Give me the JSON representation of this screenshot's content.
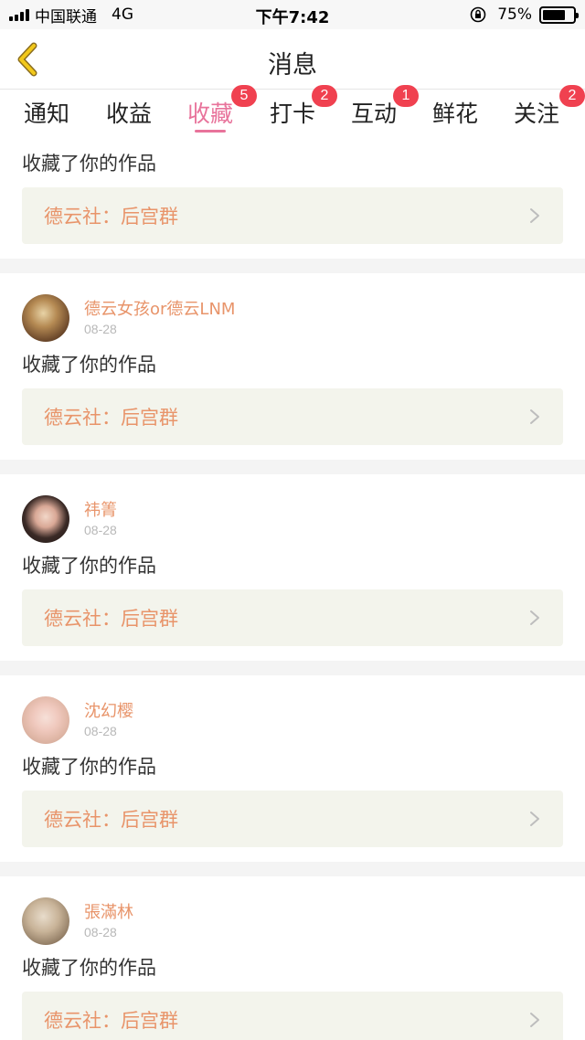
{
  "status_bar": {
    "carrier": "中国联通",
    "network": "4G",
    "time": "下午7:42",
    "battery": "75%",
    "battery_level": 0.75
  },
  "header": {
    "title": "消息",
    "back_icon": "chevron-left-icon"
  },
  "tabs": [
    {
      "label": "通知",
      "badge": null,
      "active": false
    },
    {
      "label": "收益",
      "badge": null,
      "active": false
    },
    {
      "label": "收藏",
      "badge": "5",
      "active": true
    },
    {
      "label": "打卡",
      "badge": "2",
      "active": false
    },
    {
      "label": "互动",
      "badge": "1",
      "active": false
    },
    {
      "label": "鲜花",
      "badge": null,
      "active": false
    },
    {
      "label": "关注",
      "badge": "2",
      "active": false
    }
  ],
  "colors": {
    "accent": "#e8739b",
    "badge": "#f04150",
    "username": "#e8946a",
    "work_box_bg": "#f3f4ec"
  },
  "feed": [
    {
      "action": "收藏了你的作品",
      "work_title": "德云社：后宫群"
    },
    {
      "username": "德云女孩or德云LNM",
      "date": "08-28",
      "action": "收藏了你的作品",
      "work_title": "德云社：后宫群"
    },
    {
      "username": "祎箐",
      "date": "08-28",
      "action": "收藏了你的作品",
      "work_title": "德云社：后宫群"
    },
    {
      "username": "沈幻樱",
      "date": "08-28",
      "action": "收藏了你的作品",
      "work_title": "德云社：后宫群"
    },
    {
      "username": "張滿林",
      "date": "08-28",
      "action": "收藏了你的作品",
      "work_title": "德云社：后宫群"
    }
  ]
}
